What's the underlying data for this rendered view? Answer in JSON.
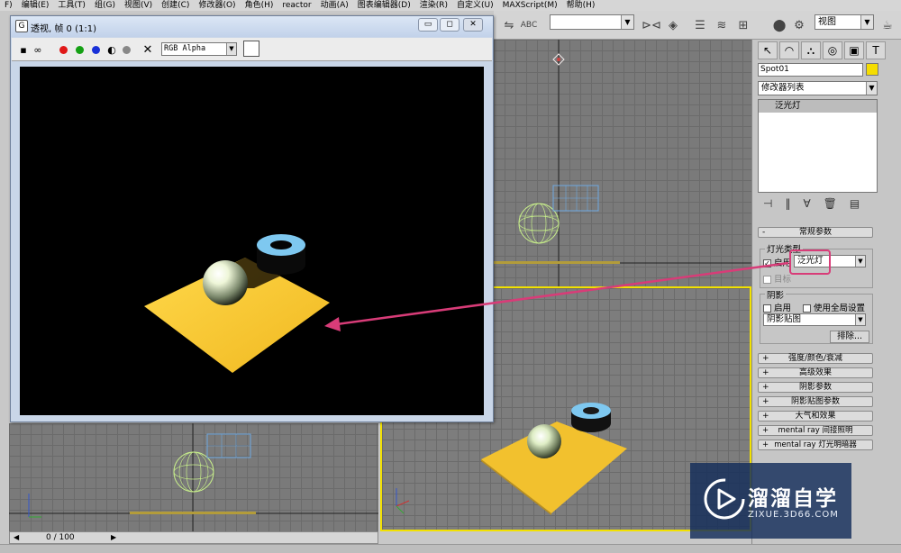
{
  "menu": [
    "F)",
    "编辑(E)",
    "工具(T)",
    "组(G)",
    "视图(V)",
    "创建(C)",
    "修改器(O)",
    "角色(H)",
    "reactor",
    "动画(A)",
    "图表编辑器(D)",
    "渲染(R)",
    "自定义(U)",
    "MAXScript(M)",
    "帮助(H)"
  ],
  "toolbar": {
    "selection_set_value": "",
    "view_combo_value": "视图"
  },
  "render_window": {
    "title": "透视, 帧 0 (1:1)",
    "channel": "RGB Alpha",
    "minimize_label": "▭",
    "restore_label": "◻",
    "close_label": "✕"
  },
  "command_panel": {
    "object_name": "Spot01",
    "object_color": "#f5dd00",
    "modifier_list": "修改器列表",
    "stack_item": "泛光灯",
    "general_rollout": "常规参数",
    "light_type_group": "灯光类型",
    "enable_label": "启用",
    "light_type_value": "泛光灯",
    "target_label": "目标",
    "shadow_group": "阴影",
    "shadow_enable_label": "启用",
    "global_settings_label": "使用全局设置",
    "shadow_type_value": "阴影贴图",
    "exclude_button": "排除...",
    "rollouts": [
      "强度/颜色/衰减",
      "高级效果",
      "阴影参数",
      "阴影贴图参数",
      "大气和效果",
      "mental ray 间接照明",
      "mental ray 灯光明暗器"
    ]
  },
  "timeline": {
    "frame_label": "0 / 100"
  },
  "watermark": {
    "title": "溜溜自学",
    "subtitle": "ZIXUE.3D66.COM"
  },
  "colors": {
    "highlight": "#d83c78",
    "active_viewport": "#f2e100",
    "floor": "#f2c12e",
    "torus": "#7ec8f0"
  }
}
